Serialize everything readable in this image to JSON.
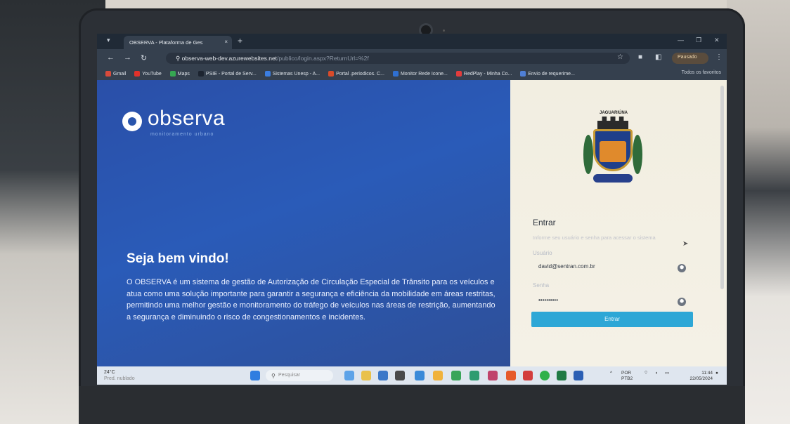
{
  "browser": {
    "tab_title": "OBSERVA - Plataforma de Ges",
    "tab_close": "×",
    "new_tab": "+",
    "url_host": "observa-web-dev.azurewebsites.net",
    "url_path": "/publico/login.aspx?ReturnUrl=%2f",
    "profile": "Pausado",
    "bookmarks": [
      {
        "label": "Gmail",
        "color": "#d84a3b"
      },
      {
        "label": "YouTube",
        "color": "#e0312a"
      },
      {
        "label": "Maps",
        "color": "#36a852"
      },
      {
        "label": "PSIE - Portal de Serv...",
        "color": "#1c2430"
      },
      {
        "label": "Sistemas Unesp - A...",
        "color": "#3b7de0"
      },
      {
        "label": "Portal .periodicos. C...",
        "color": "#d94b2a"
      },
      {
        "label": "Monitor Rede Icone...",
        "color": "#2f6fd0"
      },
      {
        "label": "RedPlay - Minha Co...",
        "color": "#e23c3c"
      },
      {
        "label": "Envio de requerime...",
        "color": "#4f7fd6"
      }
    ],
    "all_bookmarks": "Todos os favoritos"
  },
  "hero": {
    "logo": "observa",
    "logo_sub": "monitoramento urbano",
    "welcome": "Seja bem vindo!",
    "description": "O OBSERVA é um sistema de gestão de Autorização de Circulação Especial de Trânsito para os veículos e atua como uma solução importante para garantir a segurança e eficiência da mobilidade em áreas restritas, permitindo uma melhor gestão e monitoramento do tráfego de veículos nas áreas de restrição, aumentando a segurança e diminuindo o risco de congestionamentos e incidentes."
  },
  "login": {
    "coat_text": "JAGUARIÚNA",
    "title": "Entrar",
    "hint": "Informe seu usuário e senha para acessar o sistema",
    "user_label": "Usuário",
    "user_value": "david@sentran.com.br",
    "password_label": "Senha",
    "password_value": "••••••••••",
    "button": "Entrar"
  },
  "taskbar": {
    "temp": "24°C",
    "condition": "Pred. nublado",
    "search_placeholder": "Pesquisar",
    "lang_1": "POR",
    "lang_2": "PTB2",
    "time": "11:44",
    "date": "22/05/2024"
  }
}
